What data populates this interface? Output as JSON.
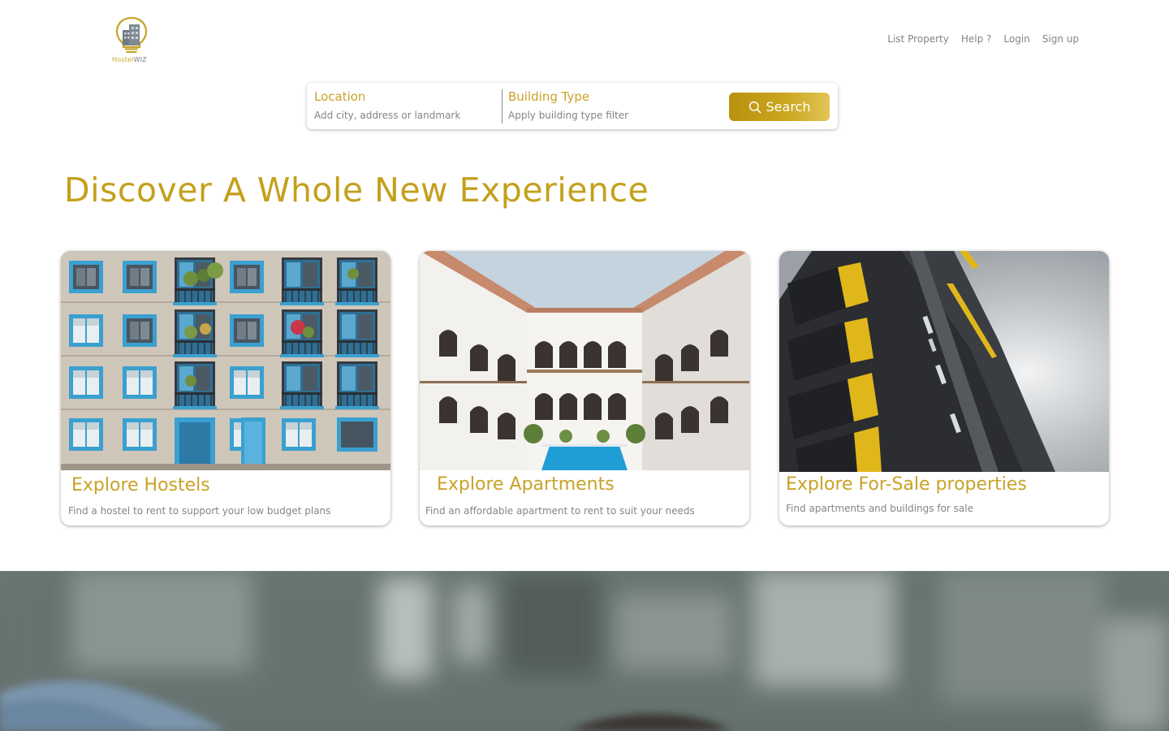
{
  "brand": {
    "name_part1": "Hostel",
    "name_part2": "WIZ"
  },
  "nav": {
    "items": [
      {
        "label": "List Property"
      },
      {
        "label": "Help ?"
      },
      {
        "label": "Login"
      },
      {
        "label": "Sign up"
      }
    ]
  },
  "search": {
    "location_label": "Location",
    "location_placeholder": "Add city, address or landmark",
    "building_label": "Building Type",
    "building_placeholder": "Apply building type filter",
    "button_label": "Search",
    "button_icon": "search-icon"
  },
  "headline": "Discover A Whole New Experience",
  "cards": [
    {
      "title": "Explore Hostels",
      "description": "Find a hostel to rent to support your low budget plans",
      "image": "hostel-building-photo"
    },
    {
      "title": "Explore Apartments",
      "description": "Find an affordable apartment to rent to suit your needs",
      "image": "apartment-courtyard-photo"
    },
    {
      "title": "Explore For-Sale properties",
      "description": "Find apartments and buildings for sale",
      "image": "modern-building-photo"
    }
  ],
  "colors": {
    "accent": "#c9a227",
    "nav_text": "#808589",
    "body_text": "#858585"
  }
}
